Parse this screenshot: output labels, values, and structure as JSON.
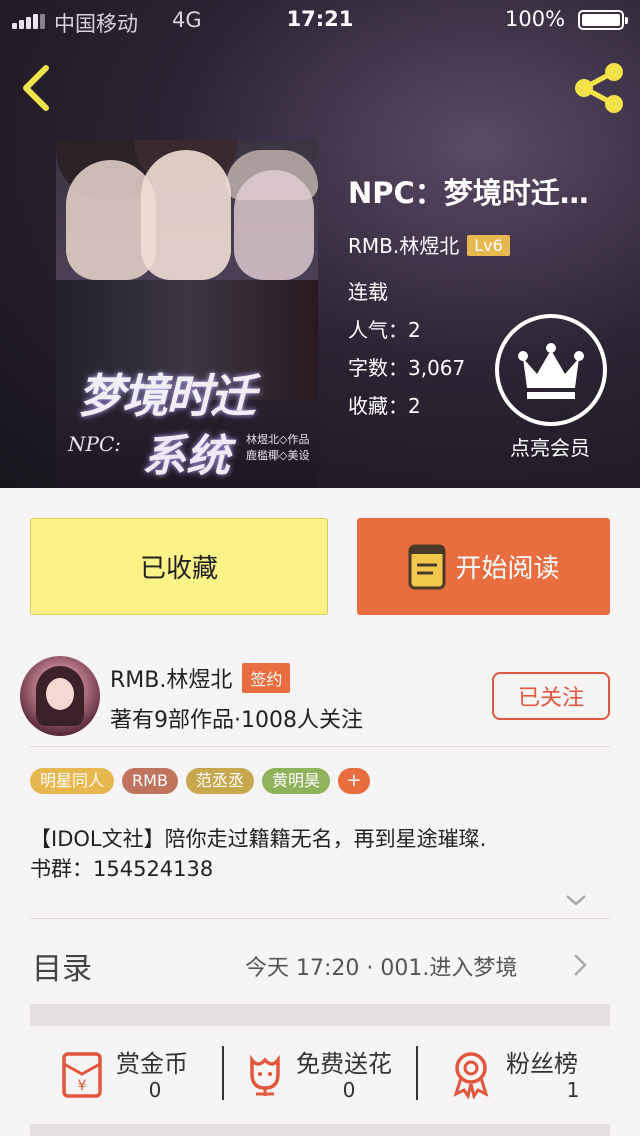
{
  "status_bar": {
    "carrier": "中国移动",
    "network": "4G",
    "time": "17:21",
    "battery": "100%"
  },
  "book": {
    "title": "NPC：梦境时迁…",
    "author": "RMB.林煜北",
    "level": "Lv6",
    "status": "连载",
    "popularity_label": "人气：",
    "popularity": "2",
    "words_label": "字数：",
    "words": "3,067",
    "favorites_label": "收藏：",
    "favorites": "2"
  },
  "cover": {
    "title_line1": "梦境时迁",
    "npc": "NPC:",
    "title_line2": "系统",
    "credit1": "林煜北◇作品",
    "credit2": "鹿槛椰◇美设"
  },
  "vip": {
    "label": "点亮会员"
  },
  "actions": {
    "favorited": "已收藏",
    "start_reading": "开始阅读"
  },
  "author_card": {
    "name": "RMB.林煜北",
    "signed_tag": "签约",
    "meta": "著有9部作品·1008人关注",
    "follow_label": "已关注"
  },
  "tags": [
    {
      "label": "明星同人",
      "color": "#e8b850"
    },
    {
      "label": "RMB",
      "color": "#c0745e"
    },
    {
      "label": "范丞丞",
      "color": "#c8a84e"
    },
    {
      "label": "黄明昊",
      "color": "#8fb35a"
    }
  ],
  "tag_add": "+",
  "intro": {
    "line1": "【IDOL文社】陪你走过籍籍无名，再到星途璀璨.",
    "line2": "书群：154524138"
  },
  "toc": {
    "label": "目录",
    "latest": "今天 17:20 · 001.进入梦境"
  },
  "stats": [
    {
      "label": "赏金币",
      "value": "0",
      "icon": "red-envelope-icon"
    },
    {
      "label": "免费送花",
      "value": "0",
      "icon": "flower-icon"
    },
    {
      "label": "粉丝榜",
      "value": "1",
      "icon": "medal-icon"
    }
  ],
  "colors": {
    "accent": "#ea6d3f",
    "favorite_bg": "#fbf387",
    "level_badge": "#e8b850",
    "icon_red": "#e0573e"
  }
}
